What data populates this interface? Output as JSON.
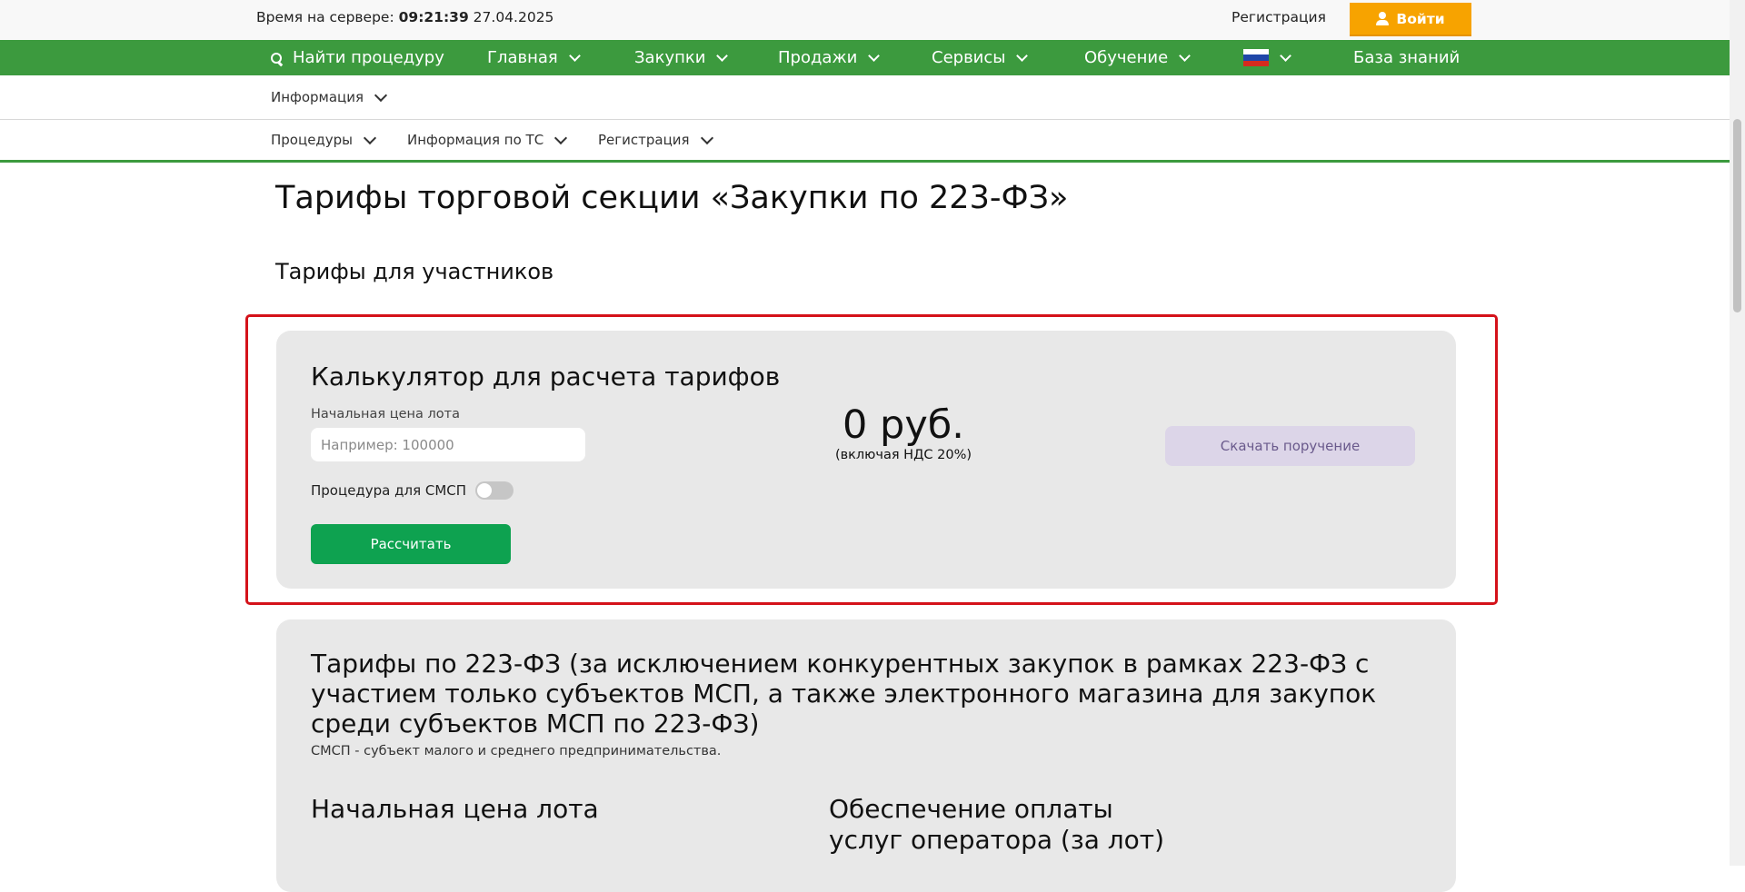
{
  "topbar": {
    "server_time_label": "Время на сервере:",
    "server_time": "09:21:39",
    "server_date": "27.04.2025",
    "register_label": "Регистрация",
    "login_label": "Войти"
  },
  "main_nav": {
    "search_label": "Найти процедуру",
    "items": [
      {
        "label": "Главная"
      },
      {
        "label": "Закупки"
      },
      {
        "label": "Продажи"
      },
      {
        "label": "Сервисы"
      },
      {
        "label": "Обучение"
      }
    ],
    "language_icon": "russia-flag-icon",
    "knowledge_base_label": "База знаний"
  },
  "subnav1": {
    "items": [
      {
        "label": "Информация"
      }
    ]
  },
  "subnav2": {
    "items": [
      {
        "label": "Процедуры"
      },
      {
        "label": "Информация по ТС"
      },
      {
        "label": "Регистрация"
      }
    ]
  },
  "content": {
    "page_title": "Тарифы торговой секции «Закупки по 223-ФЗ»",
    "section_title": "Тарифы для участников"
  },
  "calculator": {
    "title": "Калькулятор для расчета тарифов",
    "lot_price_label": "Начальная цена лота",
    "lot_price_placeholder": "Например: 100000",
    "lot_price_value": "",
    "smsp_label": "Процедура для СМСП",
    "smsp_enabled": false,
    "calculate_label": "Рассчитать",
    "result_amount": "0 руб.",
    "result_note": "(включая НДС 20%)",
    "download_label": "Скачать поручение"
  },
  "tariffs": {
    "title": "Тарифы по 223-ФЗ (за исключением конкурентных закупок в рамках 223-ФЗ с участием только субъектов МСП, а также электронного магазина для закупок среди субъектов МСП по 223-ФЗ)",
    "subtitle": "СМСП - субъект малого и среднего предпринимательства.",
    "col_lot_price": "Начальная цена лота",
    "col_operator_fee_line1": "Обеспечение оплаты",
    "col_operator_fee_line2": "услуг оператора (за лот)"
  },
  "colors": {
    "nav_green": "#3c9a3e",
    "login_orange": "#f7a300",
    "calc_button_green": "#0ea250",
    "highlight_red": "#d4121a",
    "card_gray": "#e8e8e8",
    "download_button_bg": "#dcd5e8"
  }
}
